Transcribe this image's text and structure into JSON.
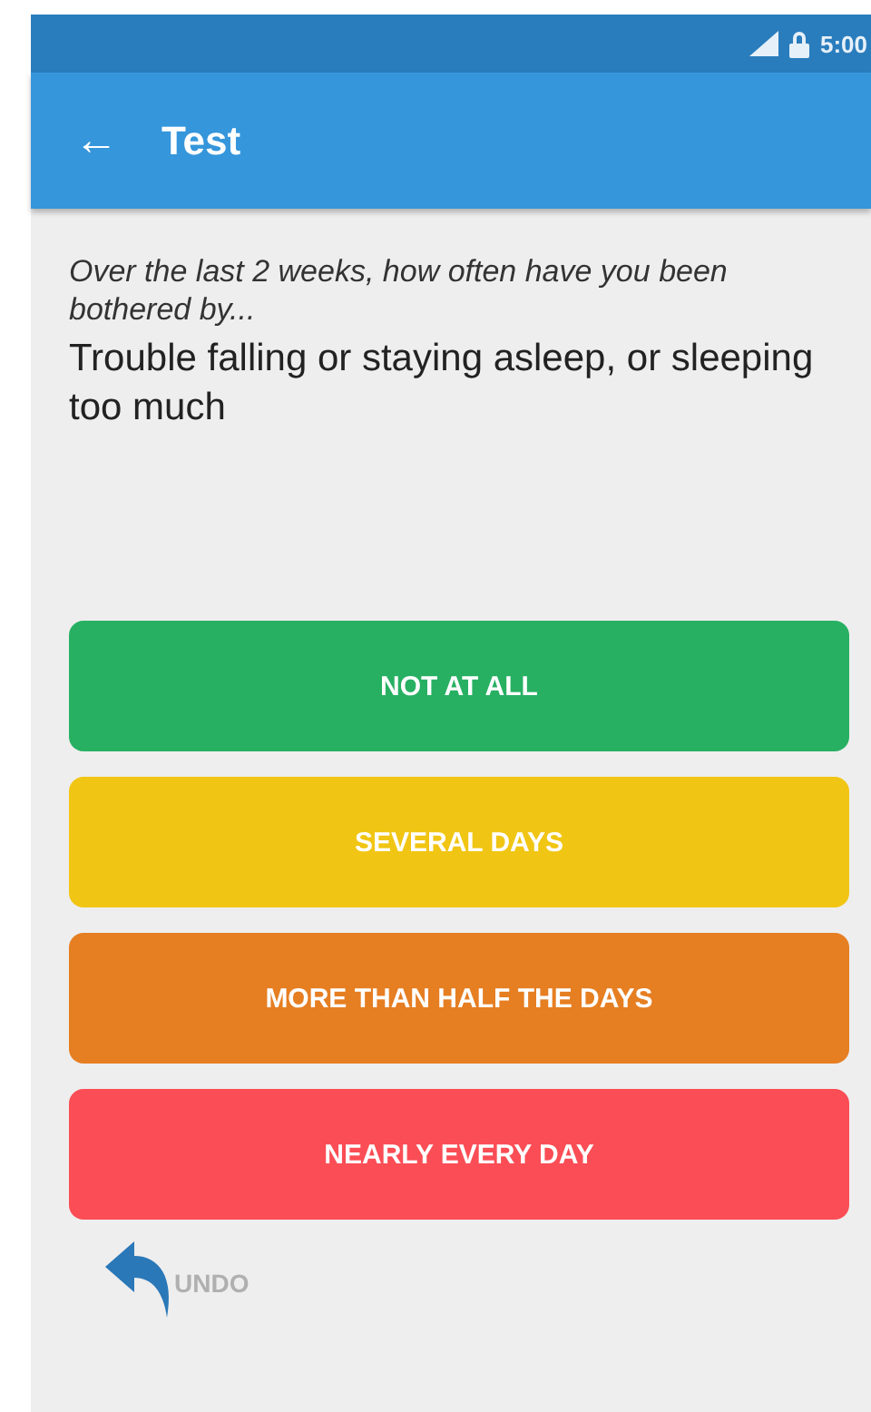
{
  "status_bar": {
    "time": "5:00"
  },
  "app_bar": {
    "back": "←",
    "title": "Test"
  },
  "question": {
    "prompt": "Over the last 2 weeks, how often have you been bothered by...",
    "item": "Trouble falling or staying asleep, or sleeping too much"
  },
  "answers": [
    {
      "label": "NOT AT ALL",
      "color": "#27b062"
    },
    {
      "label": "SEVERAL DAYS",
      "color": "#f1c513"
    },
    {
      "label": "MORE THAN HALF THE DAYS",
      "color": "#e67e22"
    },
    {
      "label": "NEARLY EVERY DAY",
      "color": "#fb4d55"
    }
  ],
  "undo": {
    "label": "UNDO"
  }
}
